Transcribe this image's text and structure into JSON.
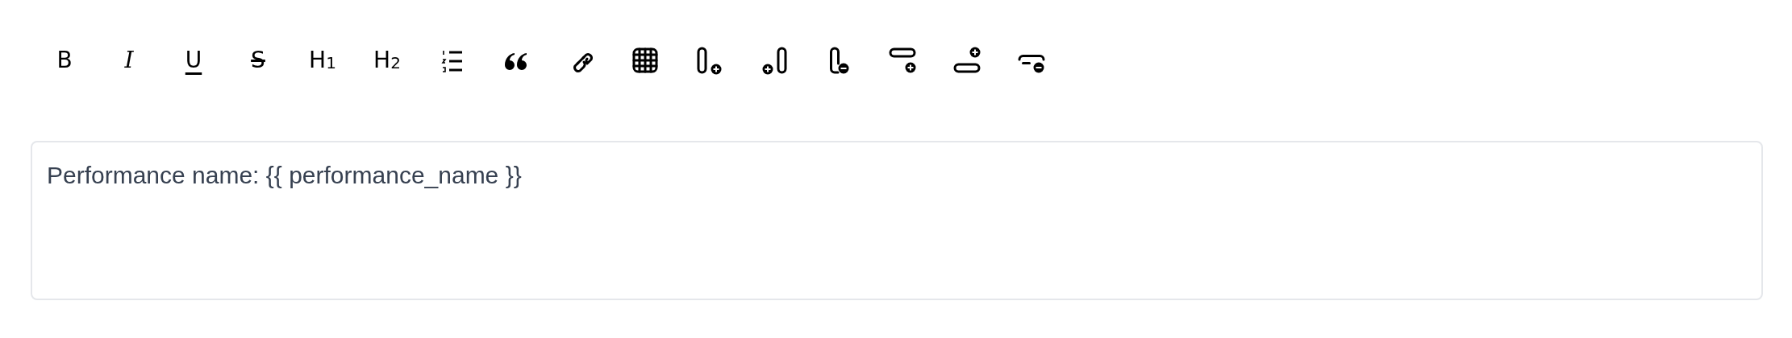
{
  "toolbar": [
    {
      "kind": "text",
      "label": "B"
    },
    {
      "kind": "text",
      "label": "I"
    },
    {
      "kind": "text",
      "label": "U"
    },
    {
      "kind": "text",
      "label": "S"
    },
    {
      "kind": "text",
      "label": "H",
      "sub": "1"
    },
    {
      "kind": "text",
      "label": "H",
      "sub": "2"
    },
    {
      "kind": "icon"
    },
    {
      "kind": "icon"
    },
    {
      "kind": "icon"
    },
    {
      "kind": "icon"
    },
    {
      "kind": "icon"
    },
    {
      "kind": "icon"
    },
    {
      "kind": "icon"
    },
    {
      "kind": "icon"
    },
    {
      "kind": "icon"
    },
    {
      "kind": "icon"
    }
  ],
  "editor": {
    "value": "Performance name: {{ performance_name }}"
  }
}
